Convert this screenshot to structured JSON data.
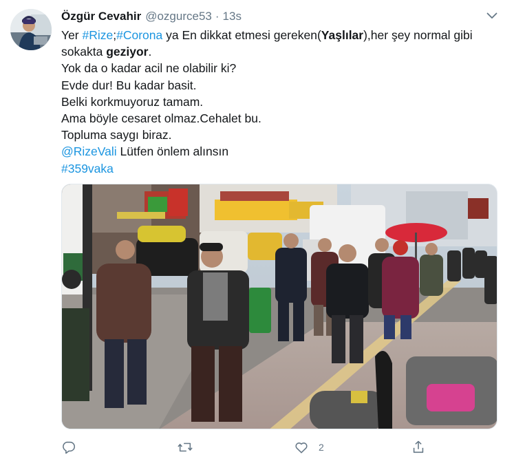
{
  "tweet": {
    "author": {
      "display_name": "Özgür Cevahir",
      "handle": "@ozgurce53",
      "separator": "·",
      "time": "13s"
    },
    "text": {
      "line1": {
        "p1": "Yer ",
        "tag_rize": "#Rize",
        "p2": ";",
        "tag_corona": "#Corona",
        "p3": " ya En dikkat etmesi gereken(",
        "bold1": "Yaşlılar",
        "p4": "),her şey normal gibi"
      },
      "line2": {
        "p1": "sokakta ",
        "bold1": "geziyor",
        "p2": "."
      },
      "line3": "Yok da o kadar acil ne olabilir ki?",
      "line4": "Evde dur! Bu kadar basit.",
      "line5": "Belki korkmuyoruz tamam.",
      "line6": "Ama böyle cesaret olmaz.Cehalet bu.",
      "line7": "Topluma saygı biraz.",
      "line8": {
        "mention": "@RizeVali",
        "p1": " Lütfen önlem alınsın"
      },
      "line9": "#359vaka"
    },
    "actions": {
      "reply_count": "",
      "retweet_count": "",
      "like_count": "2"
    }
  },
  "colors": {
    "link": "#1b95e0",
    "text": "#14171a",
    "secondary": "#657786"
  },
  "icons": {
    "menu": "chevron-down-icon",
    "reply": "reply-icon",
    "retweet": "retweet-icon",
    "like": "heart-icon",
    "share": "share-icon"
  }
}
